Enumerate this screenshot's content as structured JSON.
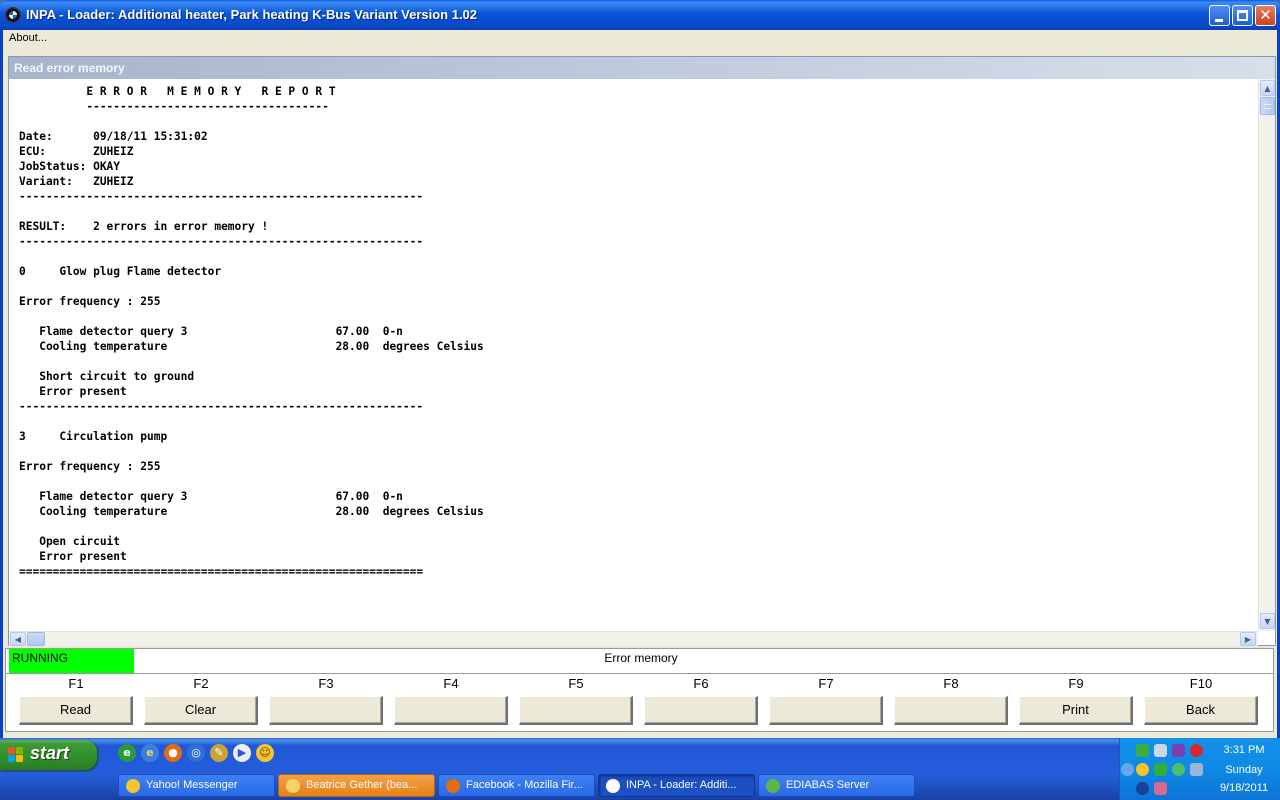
{
  "window": {
    "title": "INPA - Loader:  Additional heater, Park heating K-Bus Variant Version 1.02"
  },
  "menu": {
    "about": "About..."
  },
  "panel": {
    "caption": "Read error memory",
    "report_lines": [
      "          E R R O R   M E M O R Y   R E P O R T",
      "          ------------------------------------",
      "",
      "Date:      09/18/11 15:31:02",
      "ECU:       ZUHEIZ",
      "JobStatus: OKAY",
      "Variant:   ZUHEIZ",
      "------------------------------------------------------------",
      "",
      "RESULT:    2 errors in error memory !",
      "------------------------------------------------------------",
      "",
      "0     Glow plug Flame detector",
      "",
      "Error frequency : 255",
      "",
      "   Flame detector query 3                      67.00  0-n",
      "   Cooling temperature                         28.00  degrees Celsius",
      "",
      "   Short circuit to ground",
      "   Error present",
      "------------------------------------------------------------",
      "",
      "3     Circulation pump",
      "",
      "Error frequency : 255",
      "",
      "   Flame detector query 3                      67.00  0-n",
      "   Cooling temperature                         28.00  degrees Celsius",
      "",
      "   Open circuit",
      "   Error present",
      "============================================================"
    ]
  },
  "status": {
    "state": "RUNNING",
    "state_color": "#00ff00",
    "screen_title": "Error memory"
  },
  "function_keys": [
    {
      "key": "F1",
      "label": "Read"
    },
    {
      "key": "F2",
      "label": "Clear"
    },
    {
      "key": "F3",
      "label": ""
    },
    {
      "key": "F4",
      "label": ""
    },
    {
      "key": "F5",
      "label": ""
    },
    {
      "key": "F6",
      "label": ""
    },
    {
      "key": "F7",
      "label": ""
    },
    {
      "key": "F8",
      "label": ""
    },
    {
      "key": "F9",
      "label": "Print"
    },
    {
      "key": "F10",
      "label": "Back"
    }
  ],
  "taskbar": {
    "start_label": "start",
    "quick_launch": [
      "messenger-icon",
      "internet-explorer-icon",
      "firefox-icon",
      "windows-media-icon",
      "explorer-icon",
      "media-player-icon",
      "yahoo-messenger-icon"
    ],
    "tasks": [
      {
        "label": "Yahoo! Messenger",
        "icon": "yahoo-smiley-icon",
        "style": "normal"
      },
      {
        "label": "Beatrice Gether (bea...",
        "icon": "chat-icon",
        "style": "orange"
      },
      {
        "label": "Facebook - Mozilla Fir...",
        "icon": "firefox-icon",
        "style": "normal"
      },
      {
        "label": "INPA - Loader:  Additi...",
        "icon": "bmw-icon",
        "style": "active"
      },
      {
        "label": "EDIABAS Server",
        "icon": "ediabas-icon",
        "style": "normal"
      }
    ],
    "clock": {
      "time": "3:31 PM",
      "day": "Sunday",
      "date": "9/18/2011"
    }
  }
}
